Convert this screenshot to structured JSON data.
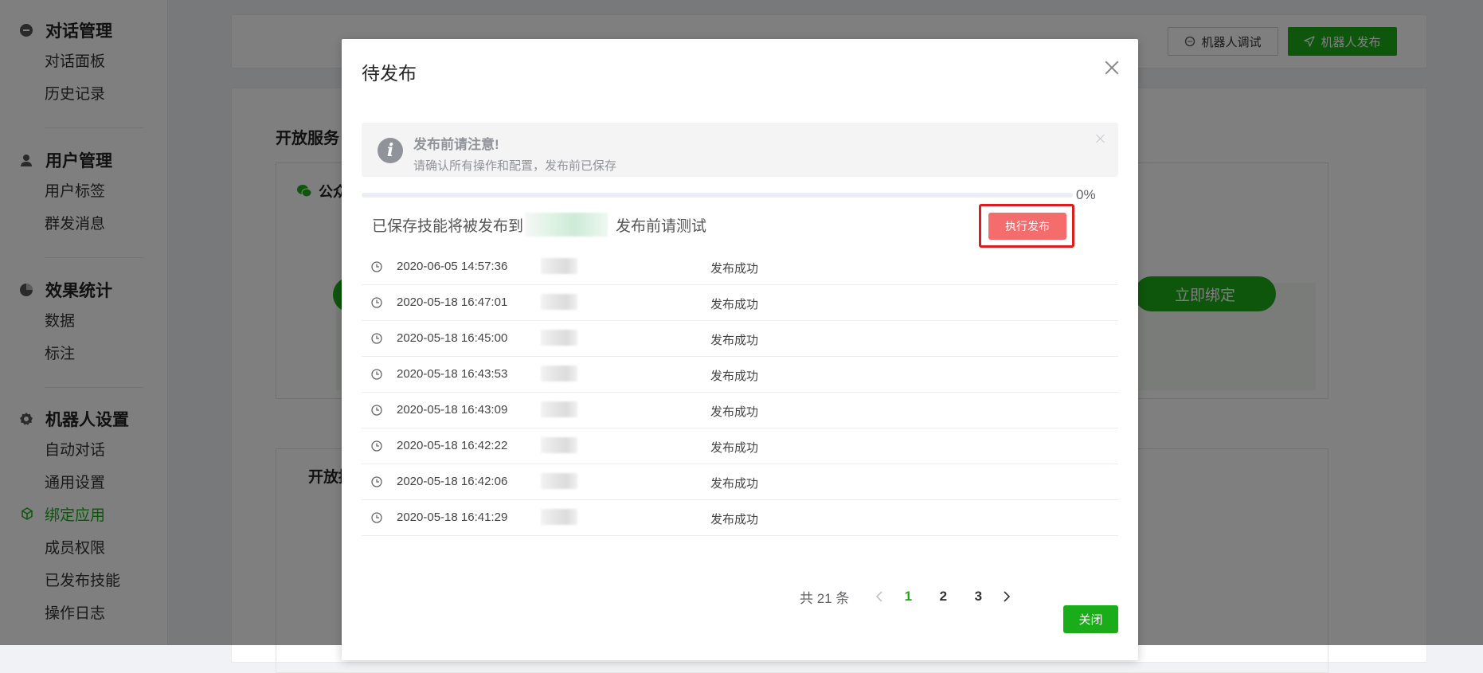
{
  "sidebar": {
    "groups": [
      {
        "title": "对话管理",
        "icon": "chat-bubble-icon",
        "items": [
          "对话面板",
          "历史记录"
        ]
      },
      {
        "title": "用户管理",
        "icon": "user-icon",
        "items": [
          "用户标签",
          "群发消息"
        ]
      },
      {
        "title": "效果统计",
        "icon": "pie-chart-icon",
        "items": [
          "数据",
          "标注"
        ]
      },
      {
        "title": "机器人设置",
        "icon": "gear-icon",
        "items": [
          "自动对话",
          "通用设置",
          "绑定应用",
          "成员权限",
          "已发布技能",
          "操作日志"
        ],
        "active_item": "绑定应用"
      }
    ]
  },
  "topbar": {
    "debug_label": "机器人调试",
    "publish_label": "机器人发布"
  },
  "main": {
    "section_title": "开放服务",
    "box_title": "公众",
    "bind_button": "立即绑定",
    "section2_title": "开放接"
  },
  "modal": {
    "title": "待发布",
    "alert": {
      "title": "发布前请注意!",
      "description": "请确认所有操作和配置，发布前已保存"
    },
    "progress": {
      "percent": 0,
      "label": "0%"
    },
    "publish_text_before": "已保存技能将被发布到",
    "publish_text_after": "发布前请测试",
    "execute_button": "执行发布",
    "history": [
      {
        "time": "2020-06-05 14:57:36",
        "status": "发布成功"
      },
      {
        "time": "2020-05-18 16:47:01",
        "status": "发布成功"
      },
      {
        "time": "2020-05-18 16:45:00",
        "status": "发布成功"
      },
      {
        "time": "2020-05-18 16:43:53",
        "status": "发布成功"
      },
      {
        "time": "2020-05-18 16:43:09",
        "status": "发布成功"
      },
      {
        "time": "2020-05-18 16:42:22",
        "status": "发布成功"
      },
      {
        "time": "2020-05-18 16:42:06",
        "status": "发布成功"
      },
      {
        "time": "2020-05-18 16:41:29",
        "status": "发布成功"
      }
    ],
    "pagination": {
      "total_label": "共 21 条",
      "pages": [
        "1",
        "2",
        "3"
      ],
      "current": "1"
    },
    "close_button": "关闭"
  },
  "colors": {
    "brand_green": "#1aad19",
    "danger": "#f56c6c",
    "highlight": "#e01b1b"
  }
}
